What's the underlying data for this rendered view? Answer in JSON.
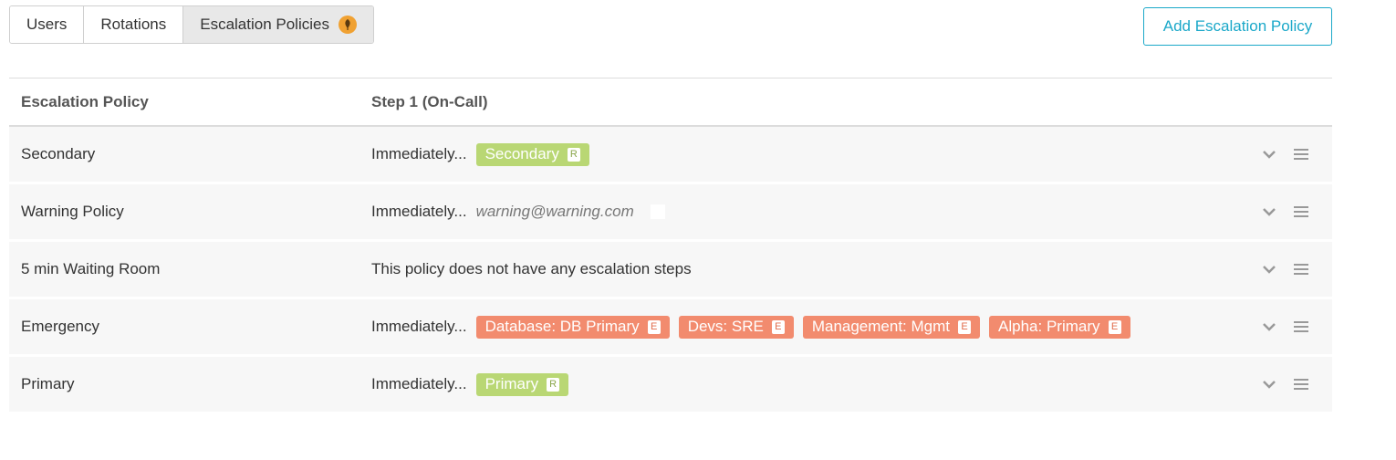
{
  "tabs": [
    {
      "label": "Users",
      "active": false
    },
    {
      "label": "Rotations",
      "active": false
    },
    {
      "label": "Escalation Policies",
      "active": true,
      "icon": "leaf-icon",
      "icon_color": "#f0a132"
    }
  ],
  "add_button": {
    "label": "Add Escalation Policy",
    "color": "#1ba8c9"
  },
  "table": {
    "headers": {
      "name": "Escalation Policy",
      "step": "Step 1 (On-Call)"
    },
    "rows": [
      {
        "name": "Secondary",
        "immediately": "Immediately...",
        "chips": [
          {
            "label": "Secondary",
            "badge": "R",
            "color": "green"
          }
        ]
      },
      {
        "name": "Warning Policy",
        "immediately": "Immediately...",
        "email": "warning@warning.com"
      },
      {
        "name": "5 min Waiting Room",
        "message": "This policy does not have any escalation steps"
      },
      {
        "name": "Emergency",
        "immediately": "Immediately...",
        "chips": [
          {
            "label": "Database: DB Primary",
            "badge": "E",
            "color": "red"
          },
          {
            "label": "Devs: SRE",
            "badge": "E",
            "color": "red"
          },
          {
            "label": "Management: Mgmt",
            "badge": "E",
            "color": "red"
          },
          {
            "label": "Alpha: Primary",
            "badge": "E",
            "color": "red"
          }
        ]
      },
      {
        "name": "Primary",
        "immediately": "Immediately...",
        "chips": [
          {
            "label": "Primary",
            "badge": "R",
            "color": "green"
          }
        ]
      }
    ]
  },
  "colors": {
    "green_chip": "#b9d774",
    "red_chip": "#f28b6e",
    "row_bg": "#f7f7f7"
  }
}
